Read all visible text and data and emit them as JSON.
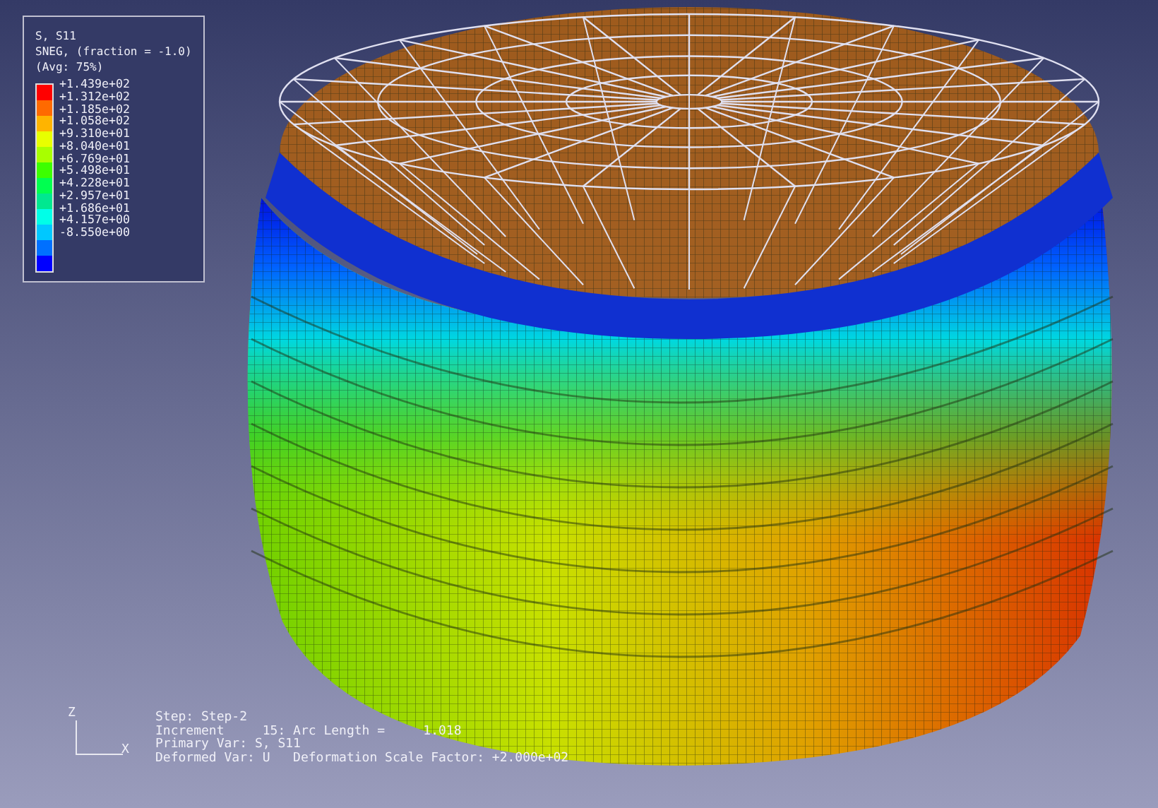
{
  "legend": {
    "title_lines": [
      "S, S11",
      "SNEG, (fraction = -1.0)",
      "(Avg: 75%)"
    ],
    "bands": [
      {
        "color": "#ff0000"
      },
      {
        "color": "#ff6a00"
      },
      {
        "color": "#ffb400"
      },
      {
        "color": "#e8ff00"
      },
      {
        "color": "#a8ff00"
      },
      {
        "color": "#3cff00"
      },
      {
        "color": "#00ff50"
      },
      {
        "color": "#00e890"
      },
      {
        "color": "#00ffe8"
      },
      {
        "color": "#00c8ff"
      },
      {
        "color": "#0070ff"
      },
      {
        "color": "#0000ff"
      }
    ],
    "values": [
      "+1.439e+02",
      "+1.312e+02",
      "+1.185e+02",
      "+1.058e+02",
      "+9.310e+01",
      "+8.040e+01",
      "+6.769e+01",
      "+5.498e+01",
      "+4.228e+01",
      "+2.957e+01",
      "+1.686e+01",
      "+4.157e+00",
      "-8.550e+00"
    ]
  },
  "triad": {
    "axis_vertical": "Z",
    "axis_horizontal": "X"
  },
  "info": [
    "Step: Step-2",
    "Increment     15: Arc Length =     1.018",
    "Primary Var: S, S11",
    "Deformed Var: U   Deformation Scale Factor: +2.000e+02"
  ]
}
